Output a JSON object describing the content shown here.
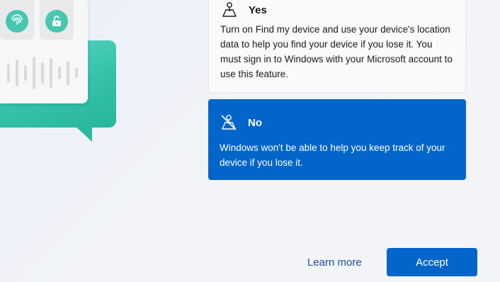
{
  "options": {
    "yes": {
      "title": "Yes",
      "description": "Turn on Find my device and use your device's location data to help you find your device if you lose it. You must sign in to Windows with your Microsoft account to use this feature.",
      "icon": "location-person-icon",
      "selected": false
    },
    "no": {
      "title": "No",
      "description": "Windows won't be able to help you keep track of your device if you lose it.",
      "icon": "location-off-icon",
      "selected": true
    }
  },
  "actions": {
    "learn_more": "Learn more",
    "accept": "Accept"
  },
  "colors": {
    "accent": "#0265c9",
    "illustration_teal": "#34c3a9"
  }
}
